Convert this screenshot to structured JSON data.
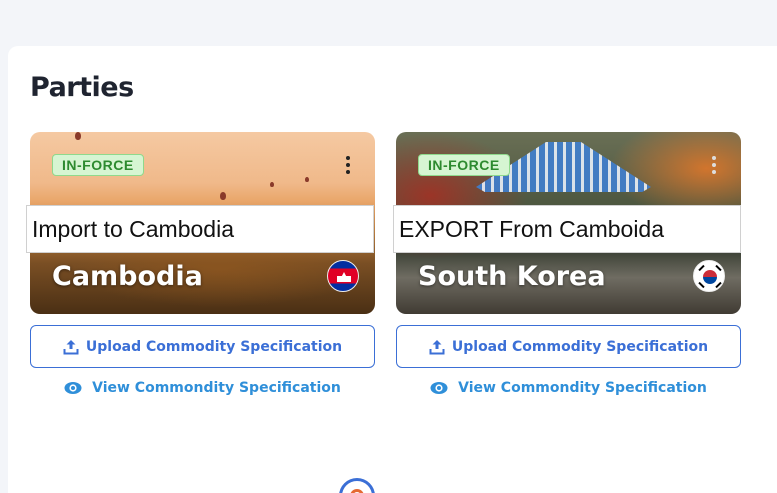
{
  "page": {
    "title": "Parties"
  },
  "cards": [
    {
      "status": "IN-FORCE",
      "overlay_text": "Import to Cambodia",
      "country": "Cambodia",
      "flag_icon": "cambodia-flag-icon",
      "upload_label": "Upload Commodity Specification",
      "view_label": "View Commondity Specification"
    },
    {
      "status": "IN-FORCE",
      "overlay_text": "EXPORT From Camboida",
      "country": "South Korea",
      "flag_icon": "south-korea-flag-icon",
      "upload_label": "Upload Commodity Specification",
      "view_label": "View Commondity Specification"
    }
  ],
  "colors": {
    "accent": "#3b6fd6",
    "link": "#2f8fd9",
    "badge_bg": "#d6f5d2",
    "badge_text": "#2d8a2f"
  },
  "icons": {
    "upload": "upload-icon",
    "view": "eye-icon",
    "menu": "more-vertical-icon"
  }
}
